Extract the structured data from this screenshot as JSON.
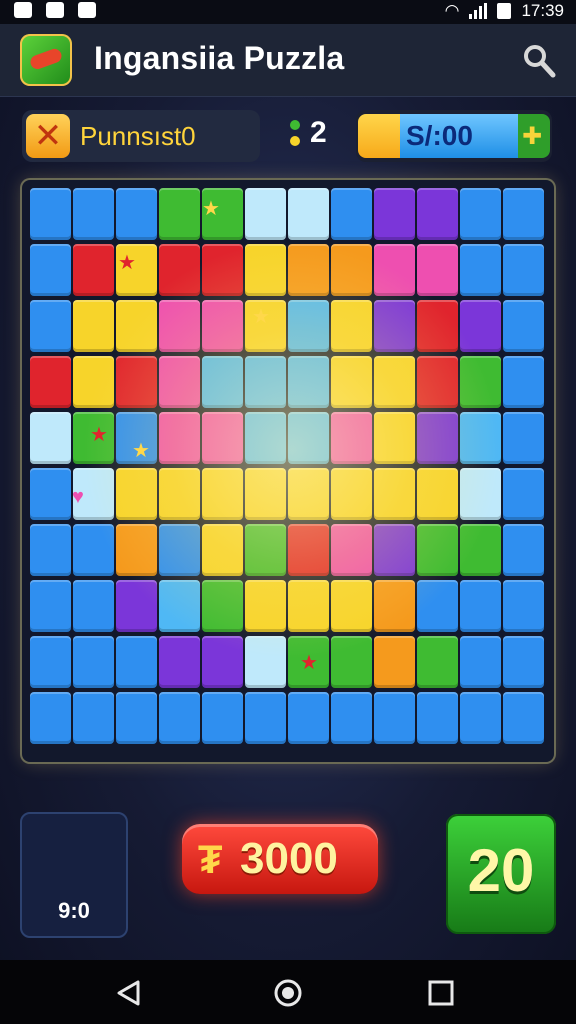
{
  "status_bar": {
    "time": "17:39"
  },
  "app_bar": {
    "title": "Ingansiia Puzzla",
    "app_icon": "game-logo-icon",
    "search_icon": "search-icon"
  },
  "hud": {
    "player_label": "Punnsıst0",
    "moves_count": "2",
    "timer_value": "S/:00"
  },
  "bottom": {
    "hold_value": "9:0",
    "score_value": "3000",
    "level_value": "20"
  },
  "navigation": {
    "back": "back-icon",
    "home": "home-icon",
    "recents": "recents-icon"
  },
  "board": {
    "columns": 12,
    "rows": 10,
    "palette": {
      "B": "#2f8ff0",
      "C": "#4fb8f5",
      "Y": "#f7d42a",
      "O": "#f59a1d",
      "R": "#e0242d",
      "P": "#ee4fb0",
      "V": "#7b36d9",
      "G": "#3fbb32",
      "W": "#bfe9fb",
      "L": "#9be05a"
    },
    "tiles": [
      "BBBGGWWBVVBB",
      "BRYRRYOOPPBB",
      "BYYPPYCYVRVB",
      "RYRPCCCYYRGB",
      "WGBPPCCPYVCB",
      "BWYYYYYYYYWB",
      "BBOBYGRPVGGB",
      "BBVCGYYYOBBB",
      "BBBVVWGGOGBB",
      "BBBBBBBBBBBB"
    ]
  }
}
